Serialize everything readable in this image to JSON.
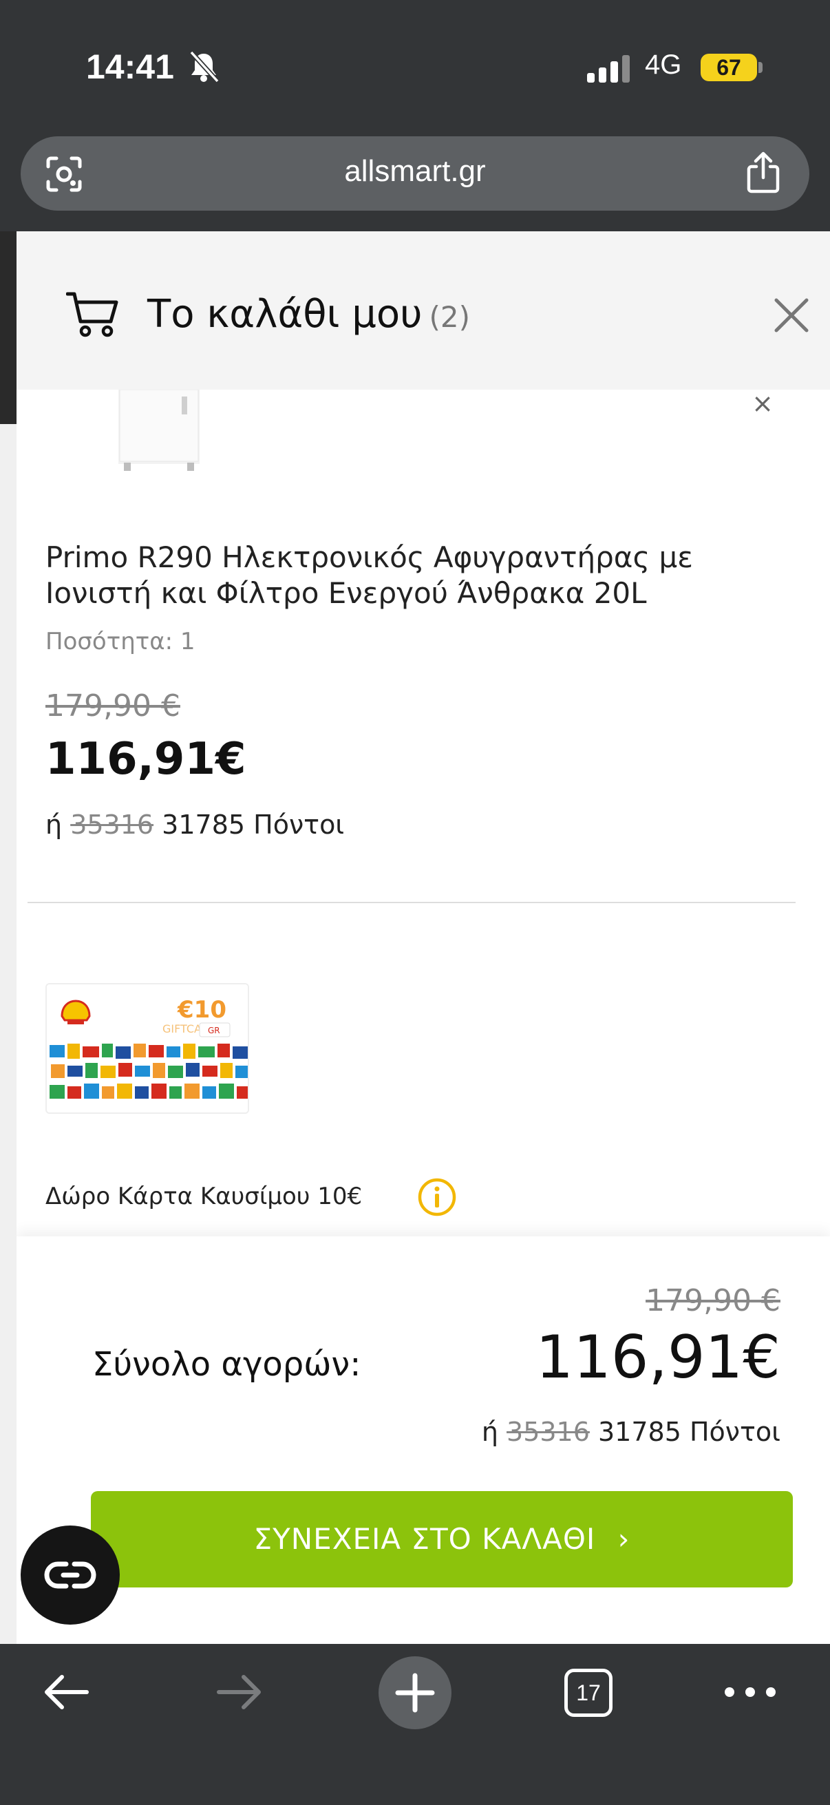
{
  "status_bar": {
    "time": "14:41",
    "network": "4G",
    "battery": "67"
  },
  "browser": {
    "url": "allsmart.gr",
    "tab_count": "17"
  },
  "cart": {
    "title": "Το καλάθι μου",
    "count": "(2)",
    "items": [
      {
        "name": "Primo R290 Ηλεκτρονικός Αφυγραντήρας με Ιονιστή και Φίλτρο Ενεργού Άνθρακα 20L",
        "quantity_label": "Ποσότητα: 1",
        "old_price": "179,90 €",
        "price": "116,91€",
        "points_prefix": "ή",
        "points_old": "35316",
        "points_new": "31785 Πόντοι"
      }
    ],
    "gift": {
      "label": "Δώρο Κάρτα Καυσίμου 10€",
      "card_amount": "€10",
      "card_text": "GIFTCARD",
      "card_country": "GR"
    }
  },
  "summary": {
    "label": "Σύνολο αγορών:",
    "old_price": "179,90 €",
    "price": "116,91€",
    "points_prefix": "ή",
    "points_old": "35316",
    "points_new": "31785 Πόντοι",
    "continue_label": "ΣΥΝΕΧΕΙΑ ΣΤΟ ΚΑΛΑΘΙ",
    "continue_chevron": "›"
  },
  "colors": {
    "accent_green": "#8cc30c",
    "info_yellow": "#f2b705",
    "battery_yellow": "#f5d21c"
  }
}
